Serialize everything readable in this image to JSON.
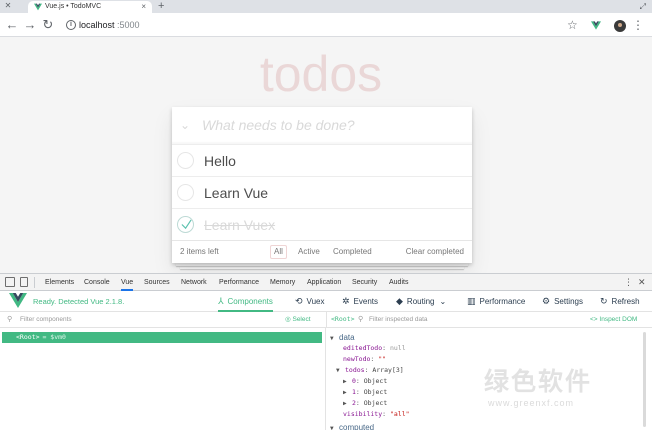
{
  "browser": {
    "tab_title": "Vue.js • TodoMVC",
    "new_tab_symbol": "+",
    "url_host": "localhost",
    "url_port": ":5000"
  },
  "app": {
    "title": "todos",
    "new_todo_placeholder": "What needs to be done?",
    "todos": [
      {
        "label": "Hello",
        "completed": false
      },
      {
        "label": "Learn Vue",
        "completed": false
      },
      {
        "label": "Learn Vuex",
        "completed": true
      }
    ],
    "footer": {
      "count_text": "2 items left",
      "filters": [
        "All",
        "Active",
        "Completed"
      ],
      "selected_filter": "All",
      "clear_completed": "Clear completed"
    },
    "title_color": "#af2f2f"
  },
  "devtools": {
    "tabs": [
      "Elements",
      "Console",
      "Vue",
      "Sources",
      "Network",
      "Performance",
      "Memory",
      "Application",
      "Security",
      "Audits"
    ],
    "active_tab": "Vue",
    "vue": {
      "status": "Ready. Detected Vue 2.1.8.",
      "nav": {
        "components": "Components",
        "vuex": "Vuex",
        "events": "Events",
        "routing": "Routing",
        "performance": "Performance",
        "settings": "Settings",
        "refresh": "Refresh"
      },
      "filter_components_placeholder": "Filter components",
      "select_label": "Select",
      "filter_inspected_placeholder": "Filter inspected data",
      "inspect_dom": "<> Inspect DOM",
      "selected_component": "Root",
      "root_row": "<Root>",
      "root_eq": "= $vm0",
      "inspector": {
        "data_section": "data",
        "lines": [
          {
            "key": "editedTodo",
            "value": "null",
            "kind": "null",
            "indent": 1,
            "caret": ""
          },
          {
            "key": "newTodo",
            "value": "\"\"",
            "kind": "str",
            "indent": 1,
            "caret": ""
          },
          {
            "key": "todos",
            "value": "Array[3]",
            "kind": "type",
            "indent": 1,
            "caret": "down"
          },
          {
            "key": "0",
            "value": "Object",
            "kind": "type",
            "indent": 2,
            "caret": "right"
          },
          {
            "key": "1",
            "value": "Object",
            "kind": "type",
            "indent": 2,
            "caret": "right"
          },
          {
            "key": "2",
            "value": "Object",
            "kind": "type",
            "indent": 2,
            "caret": "right"
          },
          {
            "key": "visibility",
            "value": "\"all\"",
            "kind": "str",
            "indent": 1,
            "caret": ""
          }
        ],
        "computed_section": "computed"
      }
    },
    "accent": "#42b983"
  },
  "watermark": {
    "text": "绿色软件",
    "url": "www.greenxf.com"
  }
}
